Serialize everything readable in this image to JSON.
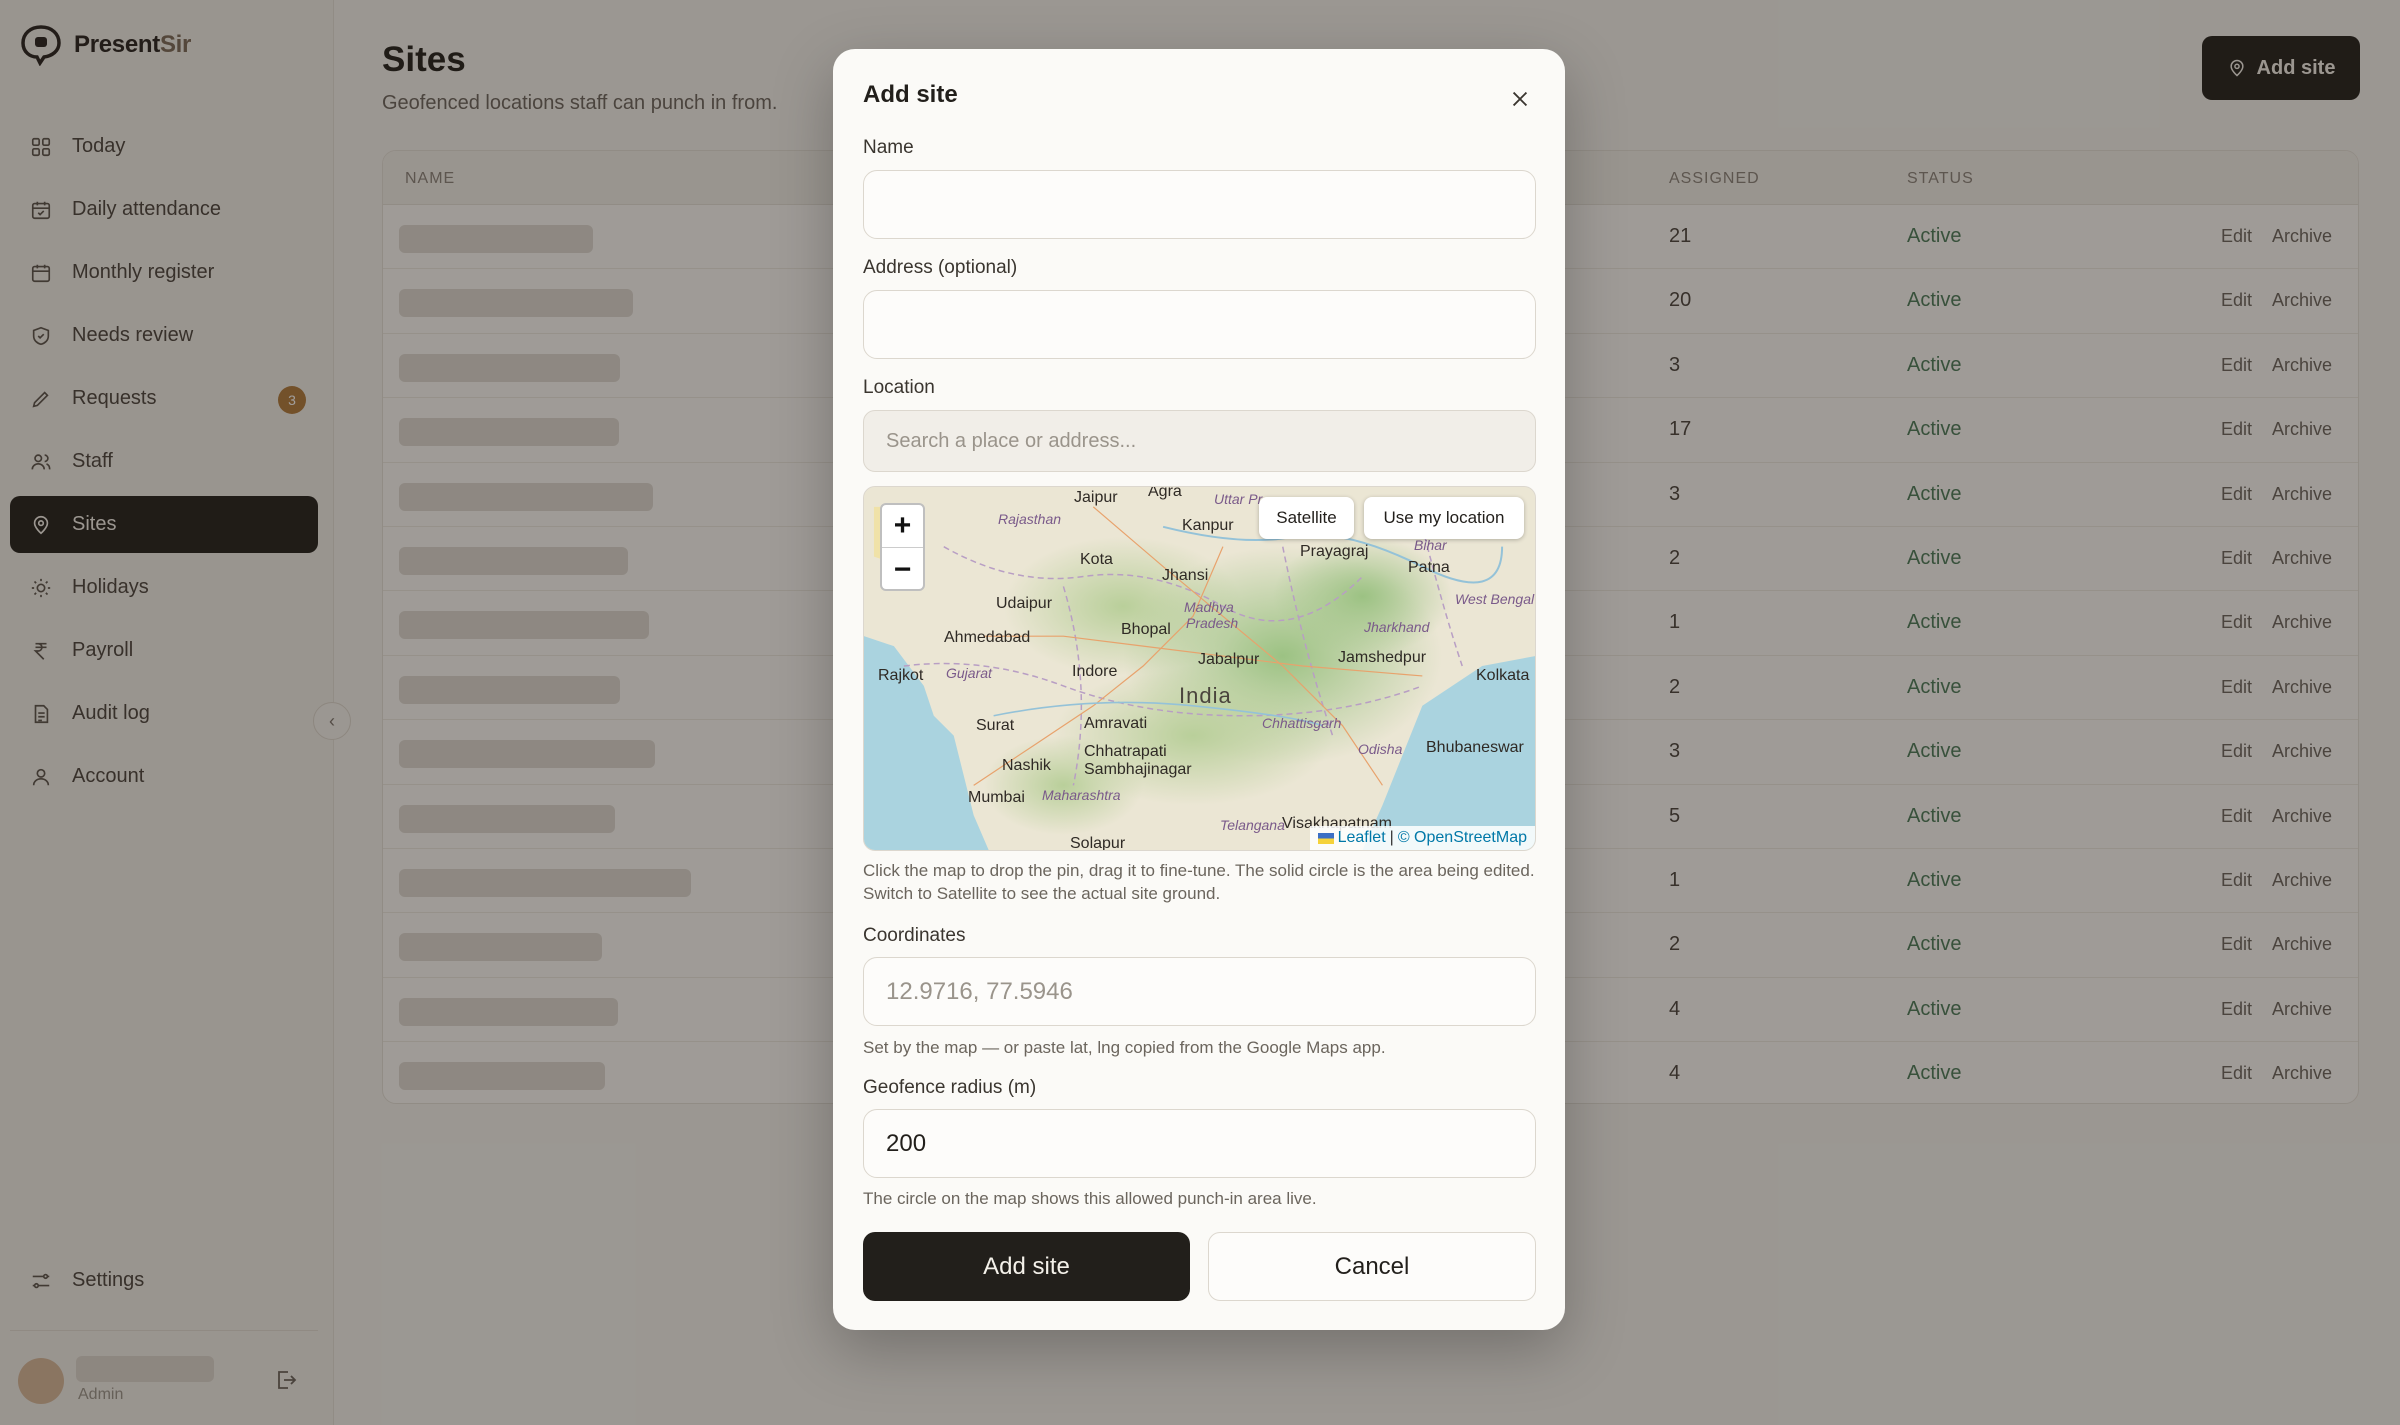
{
  "brand": {
    "name_main": "Present",
    "name_accent": "Sir"
  },
  "sidebar": {
    "items": [
      {
        "label": "Today",
        "icon": "grid-icon"
      },
      {
        "label": "Daily attendance",
        "icon": "calendar-check-icon"
      },
      {
        "label": "Monthly register",
        "icon": "calendar-icon"
      },
      {
        "label": "Needs review",
        "icon": "shield-check-icon"
      },
      {
        "label": "Requests",
        "icon": "pencil-icon",
        "badge": "3"
      },
      {
        "label": "Staff",
        "icon": "users-icon"
      },
      {
        "label": "Sites",
        "icon": "map-pin-icon",
        "active": true
      },
      {
        "label": "Holidays",
        "icon": "sun-icon"
      },
      {
        "label": "Payroll",
        "icon": "rupee-icon"
      },
      {
        "label": "Audit log",
        "icon": "file-text-icon"
      },
      {
        "label": "Account",
        "icon": "user-icon"
      }
    ],
    "settings_label": "Settings",
    "user_role": "Admin"
  },
  "page": {
    "title": "Sites",
    "subtitle": "Geofenced locations staff can punch in from.",
    "add_button_label": "Add site"
  },
  "table": {
    "columns": {
      "name": "NAME",
      "assigned": "ASSIGNED",
      "status": "STATUS"
    },
    "rows": [
      {
        "assigned": "21",
        "status": "Active",
        "edit": "Edit",
        "archive": "Archive"
      },
      {
        "assigned": "20",
        "status": "Active",
        "edit": "Edit",
        "archive": "Archive"
      },
      {
        "assigned": "3",
        "status": "Active",
        "edit": "Edit",
        "archive": "Archive"
      },
      {
        "assigned": "17",
        "status": "Active",
        "edit": "Edit",
        "archive": "Archive"
      },
      {
        "assigned": "3",
        "status": "Active",
        "edit": "Edit",
        "archive": "Archive"
      },
      {
        "assigned": "2",
        "status": "Active",
        "edit": "Edit",
        "archive": "Archive"
      },
      {
        "assigned": "1",
        "status": "Active",
        "edit": "Edit",
        "archive": "Archive"
      },
      {
        "assigned": "2",
        "status": "Active",
        "edit": "Edit",
        "archive": "Archive"
      },
      {
        "assigned": "3",
        "status": "Active",
        "edit": "Edit",
        "archive": "Archive"
      },
      {
        "assigned": "5",
        "status": "Active",
        "edit": "Edit",
        "archive": "Archive"
      },
      {
        "assigned": "1",
        "status": "Active",
        "edit": "Edit",
        "archive": "Archive"
      },
      {
        "assigned": "2",
        "status": "Active",
        "edit": "Edit",
        "archive": "Archive"
      },
      {
        "assigned": "4",
        "status": "Active",
        "edit": "Edit",
        "archive": "Archive"
      },
      {
        "assigned": "4",
        "status": "Active",
        "edit": "Edit",
        "archive": "Archive"
      }
    ]
  },
  "modal": {
    "title": "Add site",
    "name_label": "Name",
    "name_value": "",
    "address_label": "Address (optional)",
    "address_value": "",
    "location_label": "Location",
    "search_placeholder": "Search a place or address...",
    "map": {
      "satellite_label": "Satellite",
      "use_location_label": "Use my location",
      "zoom_in": "+",
      "zoom_out": "−",
      "attribution_leaflet": "Leaflet",
      "attribution_sep": "|",
      "attribution_osm": "© OpenStreetMap",
      "places": [
        "Jaipur",
        "Agra",
        "Uttar Pr",
        "Rajasthan",
        "Kanpur",
        "Prayagraj",
        "Bihar",
        "Patna",
        "Kota",
        "Jhansi",
        "Madhya",
        "Pradesh",
        "Udaipur",
        "Ahmedabad",
        "Bhopal",
        "Jharkhand",
        "West Bengal",
        "Rajkot",
        "Gujarat",
        "Indore",
        "Jabalpur",
        "Jamshedpur",
        "Kolkata",
        "India",
        "Chhattisgarh",
        "Surat",
        "Amravati",
        "Odisha",
        "Bhubaneswar",
        "Nashik",
        "Chhatrapati",
        "Sambhajinagar",
        "Mumbai",
        "Maharashtra",
        "Telangana",
        "Visakhapatnam",
        "Solapur"
      ]
    },
    "map_help": "Click the map to drop the pin, drag it to fine-tune. The solid circle is the area being edited. Switch to Satellite to see the actual site ground.",
    "coords_label": "Coordinates",
    "coords_placeholder": "12.9716, 77.5946",
    "coords_help": "Set by the map — or paste lat, lng copied from the Google Maps app.",
    "radius_label": "Geofence radius (m)",
    "radius_value": "200",
    "radius_help": "The circle on the map shows this allowed punch-in area live.",
    "submit_label": "Add site",
    "cancel_label": "Cancel"
  }
}
